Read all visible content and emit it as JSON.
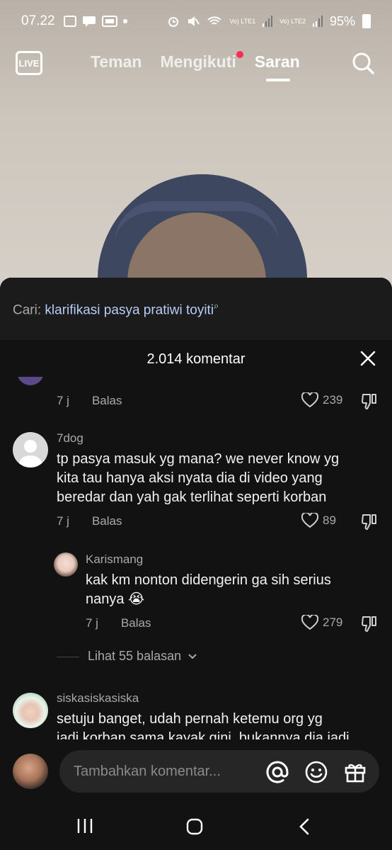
{
  "status_bar": {
    "time": "07.22",
    "left_icons": [
      "gallery-icon",
      "chat-icon",
      "webtoon-icon",
      "dot"
    ],
    "signal_text_1": "Vo) LTE1",
    "signal_text_2": "Vo) LTE2",
    "battery": "95%"
  },
  "topnav": {
    "live_label": "LIVE",
    "tabs": [
      {
        "label": "Teman",
        "active": false
      },
      {
        "label": "Mengikuti",
        "active": false,
        "notification": true
      },
      {
        "label": "Saran",
        "active": true
      }
    ]
  },
  "search_suggestion": {
    "prefix": "Cari:",
    "query": "klarifikasi pasya pratiwi toyiti"
  },
  "comments_header": {
    "title": "2.014 komentar"
  },
  "comments": [
    {
      "id": "c0",
      "partial": true,
      "time": "7 j",
      "reply_label": "Balas",
      "likes": "239"
    },
    {
      "id": "c1",
      "username": "7dog",
      "lines": [
        "tp pasya masuk yg mana? we never know yg",
        "kita tau hanya aksi nyata dia di video yang",
        "beredar dan yah gak terlihat seperti korban"
      ],
      "time": "7 j",
      "reply_label": "Balas",
      "likes": "89"
    },
    {
      "id": "c1r1",
      "username": "Karismang",
      "lines": [
        "kak km nonton didengerin ga sih serius",
        "nanya 😭"
      ],
      "time": "7 j",
      "reply_label": "Balas",
      "likes": "279"
    },
    {
      "id": "c2",
      "username": "siskasiskasiska",
      "lines": [
        "setuju banget, udah pernah ketemu org yg",
        "jadi korban sama kayak gini, bukannya dia jadi"
      ]
    }
  ],
  "view_replies": "Lihat 55 balasan",
  "input": {
    "placeholder": "Tambahkan komentar..."
  },
  "colors": {
    "accent": "#fe2c55",
    "sheet_bg": "#121212",
    "search_link": "#b5cdf7"
  }
}
